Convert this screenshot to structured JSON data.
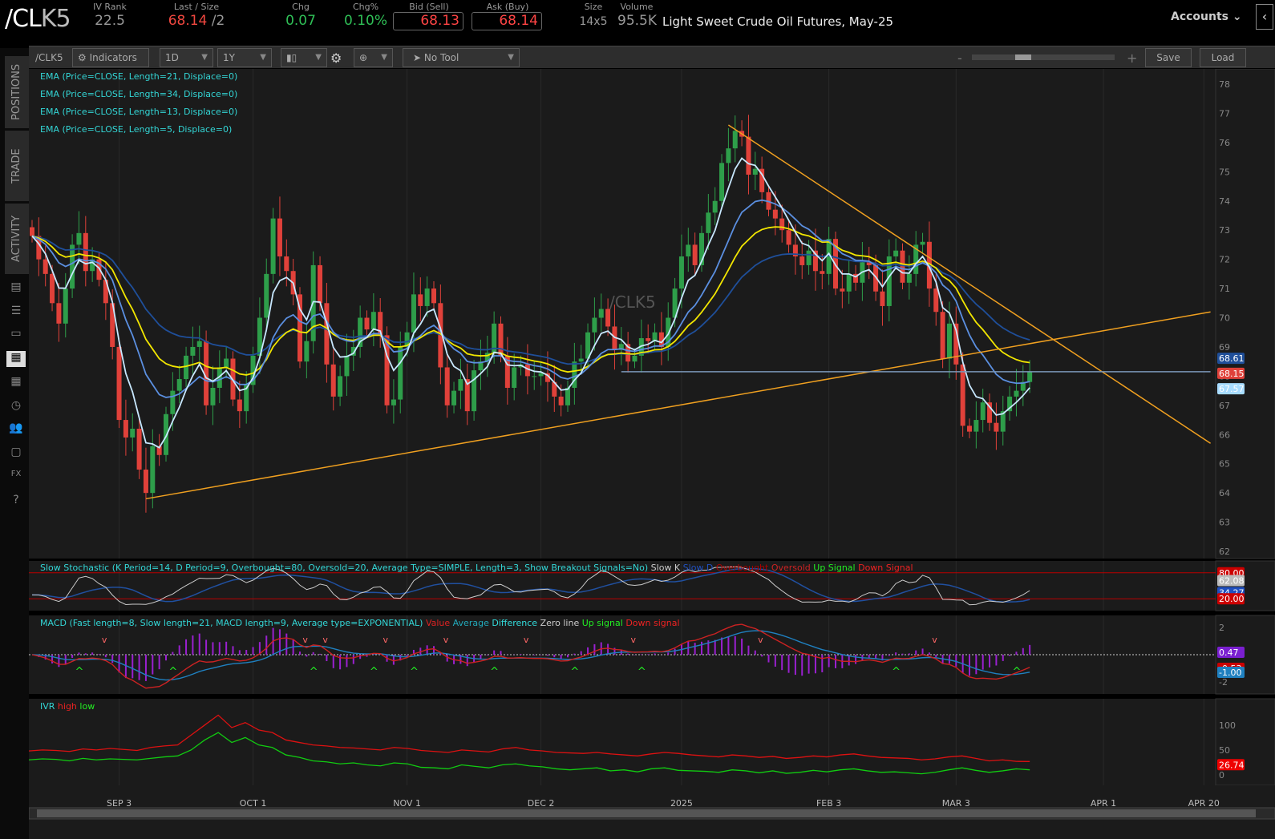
{
  "header": {
    "symbol_main": "/CL",
    "symbol_suffix": "K5",
    "iv_rank_label": "IV Rank",
    "iv_rank": "22.5",
    "last_label": "Last / Size",
    "last": "68.14",
    "size_suffix": "/2",
    "chg_label": "Chg",
    "chg": "0.07",
    "chgpct_label": "Chg%",
    "chgpct": "0.10%",
    "bid_label": "Bid (Sell)",
    "bid": "68.13",
    "ask_label": "Ask (Buy)",
    "ask": "68.14",
    "size_label": "Size",
    "size": "14x5",
    "volume_label": "Volume",
    "volume": "95.5K",
    "description": "Light Sweet Crude Oil Futures, May-25",
    "accounts": "Accounts"
  },
  "sidebar": {
    "tabs": [
      "POSITIONS",
      "TRADE",
      "ACTIVITY"
    ],
    "icons": [
      "chart-report-icon",
      "list-icon",
      "tv-icon",
      "charts-icon",
      "grid-icon",
      "clock-icon",
      "people-icon",
      "calendar-icon",
      "fx-icon",
      "help-icon"
    ]
  },
  "toolbar": {
    "symbol": "/CLK5",
    "indicators": "Indicators",
    "aggregation": "1D",
    "timeframe": "1Y",
    "tool": "No Tool",
    "zoom_minus": "-",
    "zoom_plus": "+",
    "save": "Save",
    "load": "Load"
  },
  "legends": {
    "ema": [
      "EMA (Price=CLOSE, Length=21, Displace=0)",
      "EMA (Price=CLOSE, Length=34, Displace=0)",
      "EMA (Price=CLOSE, Length=13, Displace=0)",
      "EMA (Price=CLOSE, Length=5, Displace=0)"
    ],
    "watermark": "/CLK5",
    "stoch": "Slow Stochastic (K Period=14, D Period=9, Overbought=80, Oversold=20, Average Type=SIMPLE, Length=3, Show Breakout Signals=No)",
    "stoch_items": [
      "Slow K",
      "Slow D",
      "Overbought",
      "Oversold",
      "Up Signal",
      "Down Signal"
    ],
    "macd": "MACD (Fast length=8, Slow length=21, MACD length=9, Average type=EXPONENTIAL)",
    "macd_items": [
      "Value",
      "Average",
      "Difference",
      "Zero line",
      "Up signal",
      "Down signal"
    ],
    "ivr": "IVR",
    "ivr_items": [
      "high",
      "low"
    ]
  },
  "colors": {
    "up": "#2e9e4a",
    "down": "#e0413a",
    "ema5": "#c8e8ff",
    "ema13": "#5b8fe0",
    "ema21": "#f2e600",
    "ema34": "#1f4f9a",
    "trend": "#f0a020"
  },
  "chart_data": [
    {
      "type": "candlestick",
      "title": "/CLK5 1D",
      "ylim": [
        62,
        78
      ],
      "yticks": [
        62,
        63,
        64,
        65,
        66,
        67,
        68,
        69,
        70,
        71,
        72,
        73,
        74,
        75,
        76,
        77,
        78
      ],
      "xticks": [
        {
          "label": "SEP 3",
          "index": 13
        },
        {
          "label": "OCT 1",
          "index": 33
        },
        {
          "label": "NOV 1",
          "index": 56
        },
        {
          "label": "DEC 2",
          "index": 76
        },
        {
          "label": "2025",
          "index": 97
        },
        {
          "label": "FEB 3",
          "index": 119
        },
        {
          "label": "MAR 3",
          "index": 138
        },
        {
          "label": "APR 1",
          "index": 160
        },
        {
          "label": "APR 20",
          "index": 175
        }
      ],
      "closes": [
        72.8,
        72.0,
        71.5,
        70.5,
        69.8,
        71.0,
        72.5,
        72.9,
        71.6,
        72.0,
        71.3,
        70.5,
        69.0,
        66.5,
        65.9,
        66.2,
        64.8,
        64.0,
        65.6,
        65.3,
        66.7,
        67.5,
        67.9,
        68.7,
        69.0,
        69.2,
        67.0,
        67.6,
        68.3,
        68.6,
        67.2,
        66.8,
        67.7,
        68.7,
        70.0,
        71.5,
        73.4,
        72.1,
        71.6,
        70.8,
        68.5,
        69.2,
        71.8,
        70.5,
        68.4,
        67.3,
        68.0,
        68.7,
        69.0,
        70.0,
        69.6,
        70.2,
        69.4,
        67.0,
        67.2,
        69.0,
        69.5,
        70.8,
        70.4,
        71.0,
        70.5,
        68.3,
        67.0,
        67.5,
        67.9,
        66.8,
        68.2,
        68.5,
        68.8,
        69.8,
        68.7,
        67.6,
        68.3,
        68.4,
        68.0,
        68.0,
        68.1,
        67.8,
        67.3,
        67.0,
        67.6,
        68.5,
        68.6,
        69.5,
        70.0,
        70.3,
        69.7,
        68.9,
        69.1,
        68.5,
        68.7,
        69.3,
        69.2,
        69.5,
        69.0,
        70.0,
        71.0,
        72.1,
        72.5,
        71.8,
        72.9,
        73.6,
        74.0,
        75.3,
        75.8,
        76.4,
        76.2,
        74.9,
        75.1,
        74.3,
        73.7,
        73.4,
        73.0,
        72.5,
        72.1,
        71.8,
        72.3,
        71.6,
        71.5,
        72.7,
        71.0,
        70.9,
        71.5,
        71.2,
        71.9,
        71.8,
        70.9,
        70.4,
        72.1,
        72.3,
        71.2,
        71.5,
        72.5,
        72.6,
        71.0,
        70.2,
        68.6,
        69.8,
        68.4,
        66.3,
        66.1,
        66.5,
        67.1,
        66.4,
        66.1,
        66.8,
        67.3,
        67.5,
        67.8,
        68.14
      ],
      "trendlines": [
        {
          "name": "support",
          "from": [
            17,
            63.8
          ],
          "to": [
            176,
            70.2
          ]
        },
        {
          "name": "resistance",
          "from": [
            104,
            76.6
          ],
          "to": [
            176,
            65.7
          ]
        },
        {
          "name": "horizontal",
          "from": [
            88,
            68.15
          ],
          "to": [
            176,
            68.15
          ]
        }
      ],
      "price_labels": [
        {
          "value": "68.61",
          "color": "#1f4f9a"
        },
        {
          "value": "68.15",
          "color": "#e0413a"
        },
        {
          "value": "67.57",
          "color": "#a8dcff"
        }
      ]
    },
    {
      "type": "line",
      "title": "Slow Stochastic",
      "ylim": [
        0,
        100
      ],
      "overbought": 80,
      "oversold": 20,
      "labels": [
        {
          "value": "80.00",
          "color": "#c00"
        },
        {
          "value": "62.08",
          "color": "#bbb"
        },
        {
          "value": "34.27",
          "color": "#1f4fc0"
        },
        {
          "value": "20.00",
          "color": "#c00"
        }
      ]
    },
    {
      "type": "bar+line",
      "title": "MACD",
      "ylim": [
        -2.5,
        2.5
      ],
      "yticks": [
        2,
        -2
      ],
      "labels": [
        {
          "value": "0.47",
          "color": "#7a1fd0"
        },
        {
          "value": "-0.53",
          "color": "#c00"
        },
        {
          "value": "-1.00",
          "color": "#1f80c0"
        }
      ]
    },
    {
      "type": "line",
      "title": "IVR",
      "ylim": [
        -5,
        140
      ],
      "yticks": [
        100,
        50,
        0
      ],
      "high": [
        48,
        50,
        49,
        47,
        52,
        50,
        53,
        51,
        49,
        55,
        58,
        60,
        80,
        100,
        120,
        95,
        105,
        90,
        85,
        70,
        65,
        60,
        58,
        55,
        54,
        52,
        50,
        55,
        53,
        49,
        47,
        45,
        50,
        48,
        46,
        52,
        55,
        50,
        48,
        45,
        44,
        43,
        45,
        42,
        40,
        38,
        42,
        45,
        43,
        40,
        38,
        36,
        40,
        38,
        35,
        37,
        33,
        35,
        38,
        36,
        40,
        42,
        38,
        35,
        34,
        33,
        30,
        32,
        36,
        38,
        33,
        28,
        30,
        27,
        26.74
      ],
      "low": [
        30,
        32,
        31,
        28,
        33,
        30,
        32,
        31,
        30,
        33,
        36,
        38,
        50,
        70,
        85,
        65,
        75,
        60,
        55,
        40,
        35,
        28,
        26,
        22,
        24,
        20,
        18,
        24,
        22,
        15,
        14,
        12,
        20,
        17,
        14,
        20,
        22,
        18,
        16,
        12,
        10,
        12,
        14,
        8,
        10,
        6,
        12,
        14,
        9,
        8,
        7,
        5,
        10,
        8,
        4,
        8,
        3,
        5,
        9,
        6,
        10,
        12,
        8,
        5,
        6,
        4,
        2,
        5,
        10,
        14,
        9,
        5,
        8,
        12,
        10
      ],
      "labels": [
        {
          "value": "26.74",
          "color": "#e00"
        }
      ]
    }
  ]
}
